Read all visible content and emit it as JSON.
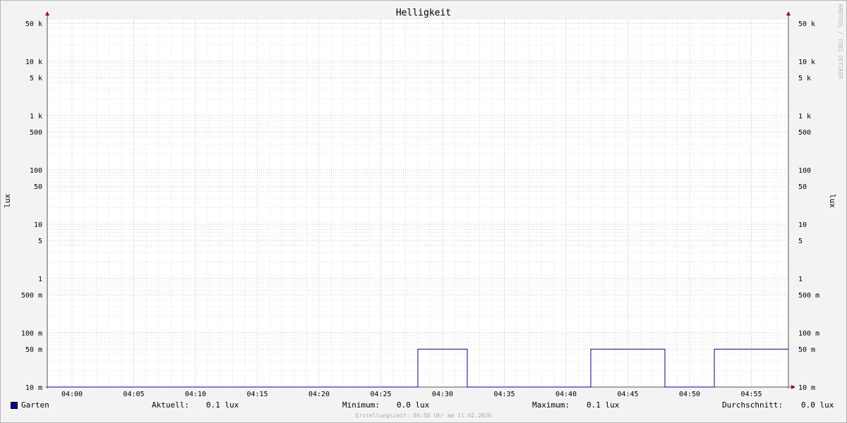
{
  "watermark": "RRDTOOL / TOBI OETIKER",
  "timestamp": "Erstellungszeit: 04:58 Uhr am 11.02.2026",
  "legend": {
    "series_name": "Garten",
    "current_label": "Aktuell:",
    "current_value": "0.1 lux",
    "min_label": "Minimum:",
    "min_value": "0.0 lux",
    "max_label": "Maximum:",
    "max_value": "0.1 lux",
    "avg_label": "Durchschnitt:",
    "avg_value": "0.0 lux"
  },
  "colors": {
    "series": "#0000a0",
    "major_grid": "#e8a0a0",
    "minor_grid": "#c8c8c8",
    "axis": "#555555",
    "arrow": "#a00000"
  },
  "chart_data": {
    "type": "line",
    "title": "Helligkeit",
    "ylabel": "lux",
    "y_scale": "log",
    "ylim": [
      0.01,
      60000
    ],
    "xlim": [
      "03:58",
      "04:58"
    ],
    "x_ticks": [
      "04:00",
      "04:05",
      "04:10",
      "04:15",
      "04:20",
      "04:25",
      "04:30",
      "04:35",
      "04:40",
      "04:45",
      "04:50",
      "04:55"
    ],
    "y_ticks": [
      {
        "value": 0.01,
        "label": "10 m"
      },
      {
        "value": 0.05,
        "label": "50 m"
      },
      {
        "value": 0.1,
        "label": "100 m"
      },
      {
        "value": 0.5,
        "label": "500 m"
      },
      {
        "value": 1,
        "label": "1"
      },
      {
        "value": 5,
        "label": "5"
      },
      {
        "value": 10,
        "label": "10"
      },
      {
        "value": 50,
        "label": "50"
      },
      {
        "value": 100,
        "label": "100"
      },
      {
        "value": 500,
        "label": "500"
      },
      {
        "value": 1000,
        "label": "1 k"
      },
      {
        "value": 5000,
        "label": "5 k"
      },
      {
        "value": 10000,
        "label": "10 k"
      },
      {
        "value": 50000,
        "label": "50 k"
      }
    ],
    "grid": true,
    "legend": "bottom",
    "series": [
      {
        "name": "Garten",
        "x": [
          "03:58",
          "04:28",
          "04:28",
          "04:32",
          "04:32",
          "04:42",
          "04:42",
          "04:48",
          "04:48",
          "04:52",
          "04:52",
          "04:58"
        ],
        "y": [
          0.01,
          0.01,
          0.05,
          0.05,
          0.01,
          0.01,
          0.05,
          0.05,
          0.01,
          0.01,
          0.05,
          0.05
        ]
      }
    ]
  }
}
